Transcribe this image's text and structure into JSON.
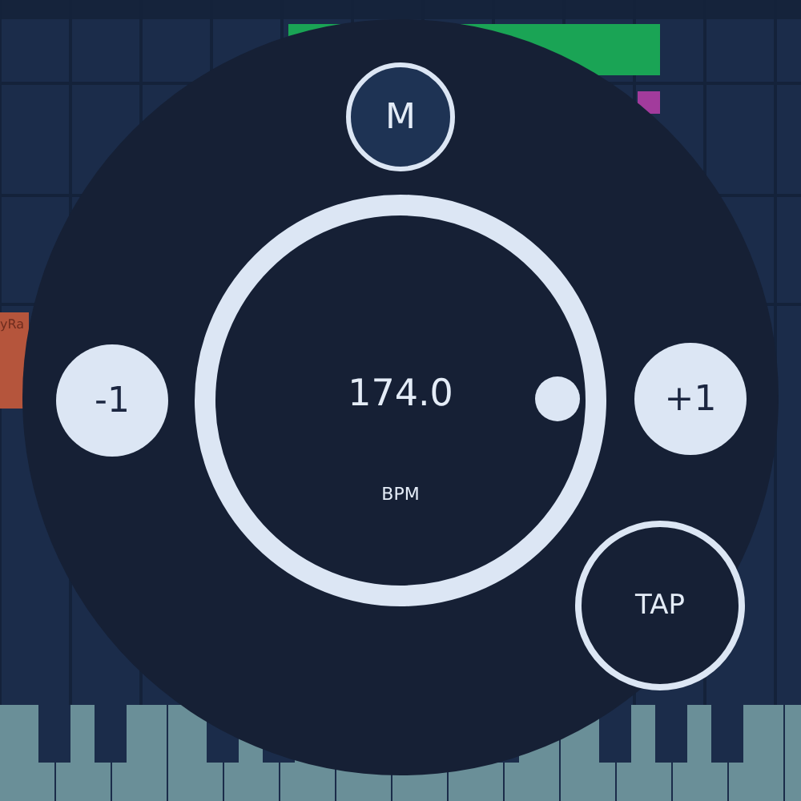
{
  "background": {
    "clip_label": "yRa"
  },
  "tempo": {
    "value": "174.0",
    "unit": "BPM"
  },
  "buttons": [
    {
      "kind": "mode",
      "label": "M"
    },
    {
      "kind": "decrement",
      "label": "-1"
    },
    {
      "kind": "increment",
      "label": "+1"
    },
    {
      "kind": "tap",
      "label": "TAP"
    }
  ]
}
